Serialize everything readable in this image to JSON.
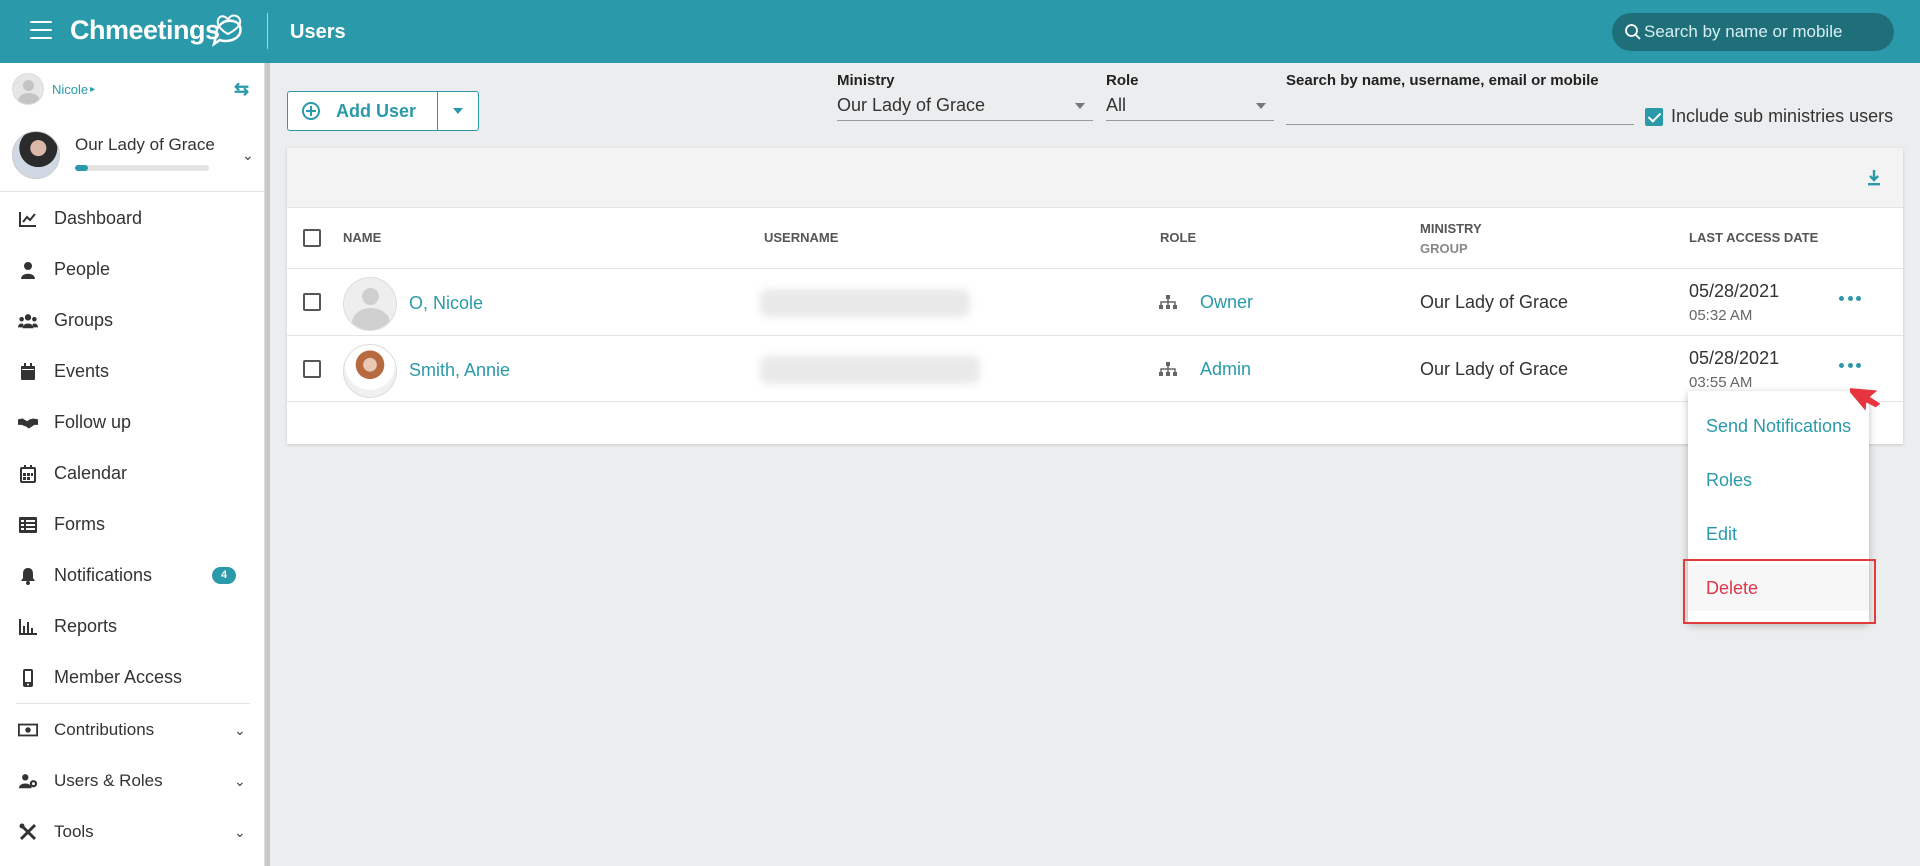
{
  "header": {
    "brand": "Chmeetings",
    "page_title": "Users",
    "search_placeholder": "Search by name or mobile",
    "color": "#2a9aaa"
  },
  "sidebar": {
    "user_name": "Nicole",
    "org_name": "Our Lady of Grace",
    "org_progress": 0.1,
    "items": [
      {
        "label": "Dashboard",
        "icon": "chart-line-icon"
      },
      {
        "label": "People",
        "icon": "person-icon"
      },
      {
        "label": "Groups",
        "icon": "users-icon"
      },
      {
        "label": "Events",
        "icon": "calendar-icon"
      },
      {
        "label": "Follow up",
        "icon": "handshake-icon"
      },
      {
        "label": "Calendar",
        "icon": "calendar-grid-icon"
      },
      {
        "label": "Forms",
        "icon": "list-icon"
      },
      {
        "label": "Notifications",
        "icon": "bell-icon",
        "badge": "4"
      },
      {
        "label": "Reports",
        "icon": "bar-chart-icon"
      },
      {
        "label": "Member Access",
        "icon": "mobile-icon"
      },
      {
        "label": "Contributions",
        "icon": "money-icon"
      },
      {
        "label": "Users & Roles",
        "icon": "users-cog-icon"
      },
      {
        "label": "Tools",
        "icon": "tools-icon"
      }
    ]
  },
  "toolbar": {
    "add_user_label": "Add User",
    "ministry_label": "Ministry",
    "ministry_value": "Our Lady of Grace",
    "role_label": "Role",
    "role_value": "All",
    "search_label": "Search by name, username, email or mobile",
    "search_value": "",
    "include_sub_label": "Include sub ministries users",
    "include_sub_checked": true
  },
  "table": {
    "columns": {
      "name": "NAME",
      "username": "USERNAME",
      "role": "ROLE",
      "ministry": "MINISTRY",
      "ministry_sub": "GROUP",
      "last_access": "LAST ACCESS DATE"
    },
    "rows": [
      {
        "name": "O, Nicole",
        "role": "Owner",
        "ministry": "Our Lady of Grace",
        "date": "05/28/2021",
        "time": "05:32 AM"
      },
      {
        "name": "Smith, Annie",
        "role": "Admin",
        "ministry": "Our Lady of Grace",
        "date": "05/28/2021",
        "time": "03:55 AM"
      }
    ]
  },
  "row_menu": {
    "items": [
      "Send Notifications",
      "Roles",
      "Edit",
      "Delete"
    ],
    "danger_color": "#e0364a"
  }
}
